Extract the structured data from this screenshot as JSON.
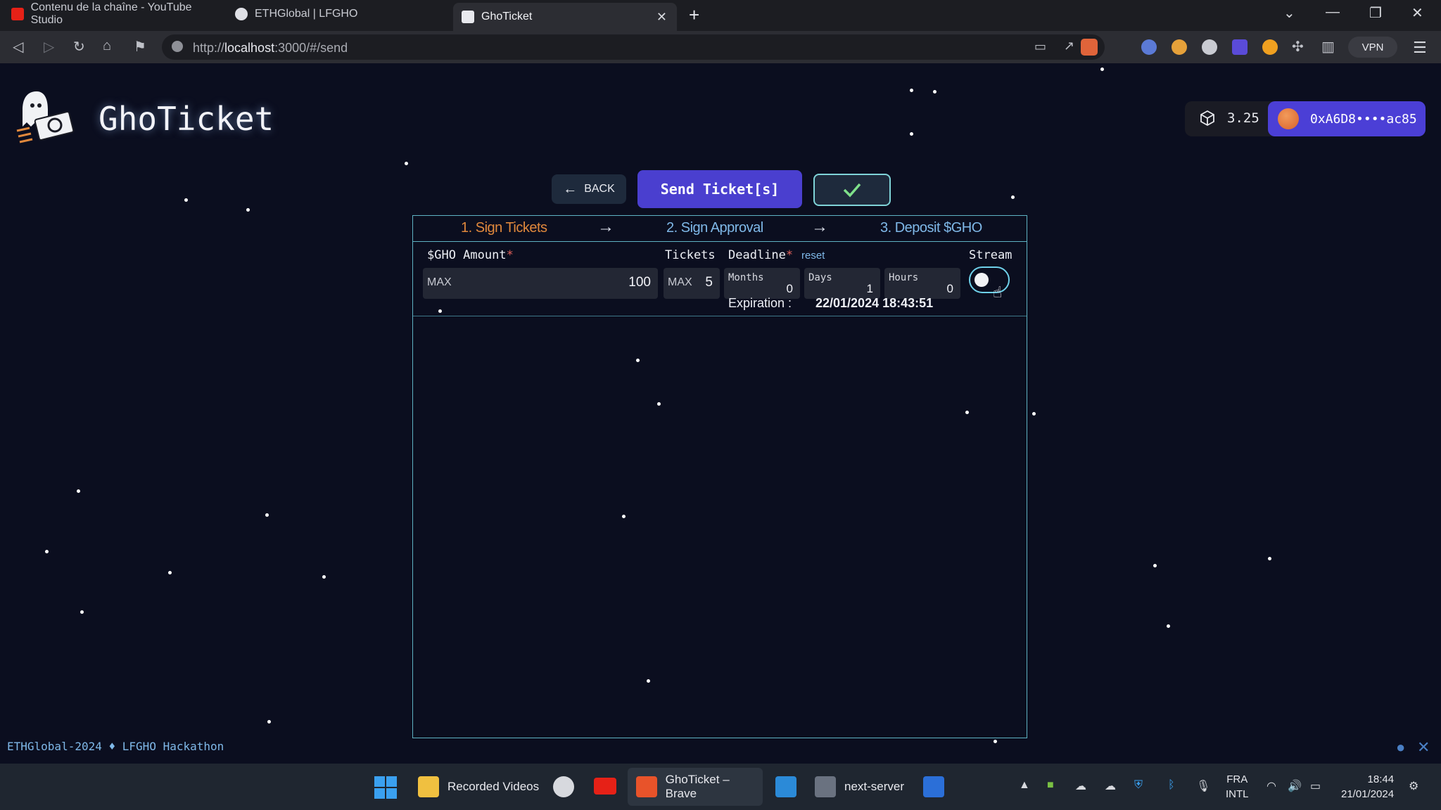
{
  "browser": {
    "tabs": [
      {
        "title": "Contenu de la chaîne - YouTube Studio"
      },
      {
        "title": "ETHGlobal | LFGHO"
      },
      {
        "title": "GhoTicket"
      }
    ],
    "url_prefix": "http://",
    "url_host": "localhost",
    "url_rest": ":3000/#/send",
    "vpn_label": "VPN"
  },
  "app": {
    "name": "GhoTicket",
    "wallet": {
      "balance": "3.25",
      "address": "0xA6D8••••ac85"
    },
    "buttons": {
      "back": "BACK",
      "send": "Send Ticket[s]"
    },
    "steps": [
      {
        "label": "1. Sign Tickets",
        "color": "#e0883c"
      },
      {
        "label": "2. Sign Approval",
        "color": "#7fb8e8"
      },
      {
        "label": "3. Deposit $GHO",
        "color": "#7fb8e8"
      }
    ],
    "form": {
      "amount_label": "$GHO Amount",
      "tickets_label": "Tickets",
      "deadline_label": "Deadline",
      "required_mark": "*",
      "reset_label": "reset",
      "stream_label": "Stream",
      "max_label": "MAX",
      "amount_value": "100",
      "tickets_value": "5",
      "months_label": "Months",
      "months_value": "0",
      "days_label": "Days",
      "days_value": "1",
      "hours_label": "Hours",
      "hours_value": "0",
      "expiration_label": "Expiration :",
      "expiration_value": "22/01/2024 18:43:51"
    },
    "footer": {
      "event": "ETHGlobal-2024",
      "hackathon": "LFGHO Hackathon"
    }
  },
  "taskbar": {
    "items": [
      {
        "label": "Recorded Videos"
      },
      {
        "label": "GhoTicket – Brave"
      },
      {
        "label": "next-server"
      }
    ],
    "lang": "FRA",
    "layout": "INTL",
    "time": "18:44",
    "date": "21/01/2024"
  }
}
